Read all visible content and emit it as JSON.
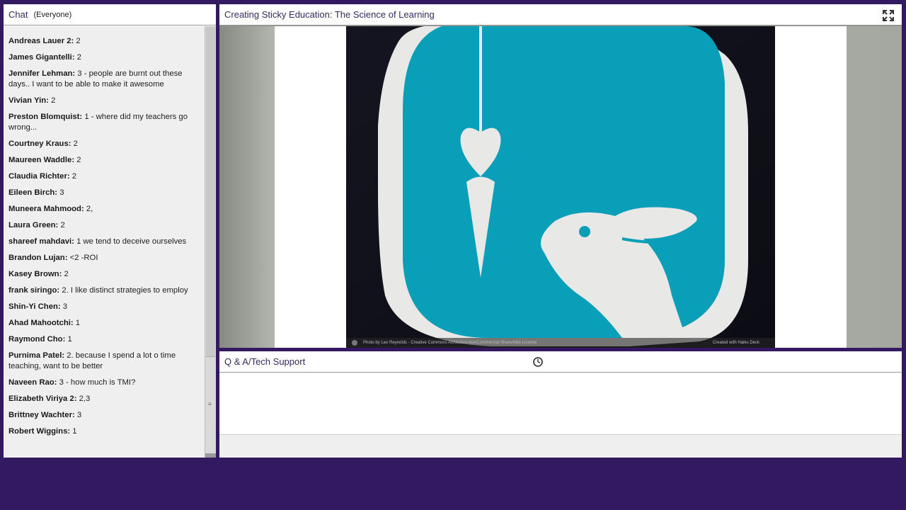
{
  "chat": {
    "title": "Chat",
    "audience": "(Everyone)",
    "messages": [
      {
        "name": "Andreas Lauer 2:",
        "text": " 2"
      },
      {
        "name": "James Gigantelli:",
        "text": " 2"
      },
      {
        "name": "Jennifer Lehman:",
        "text": " 3 - people are burnt out these days.. I want to be able to make it awesome"
      },
      {
        "name": "Vivian Yin:",
        "text": " 2"
      },
      {
        "name": "Preston Blomquist:",
        "text": " 1 - where did my teachers go wrong..."
      },
      {
        "name": "Courtney Kraus:",
        "text": " 2"
      },
      {
        "name": "Maureen Waddle:",
        "text": " 2"
      },
      {
        "name": "Claudia Richter:",
        "text": " 2"
      },
      {
        "name": "Eileen Birch:",
        "text": " 3"
      },
      {
        "name": "Muneera Mahmood:",
        "text": " 2,"
      },
      {
        "name": "Laura Green:",
        "text": " 2"
      },
      {
        "name": "shareef mahdavi:",
        "text": " 1 we tend to deceive ourselves"
      },
      {
        "name": "Brandon Lujan:",
        "text": " <2 -ROI"
      },
      {
        "name": "Kasey Brown:",
        "text": " 2"
      },
      {
        "name": "frank siringo:",
        "text": " 2. I like distinct strategies to employ"
      },
      {
        "name": "Shin-Yi Chen:",
        "text": " 3"
      },
      {
        "name": "Ahad Mahootchi:",
        "text": " 1"
      },
      {
        "name": "Raymond Cho:",
        "text": " 1"
      },
      {
        "name": "Purnima Patel:",
        "text": " 2. because I spend a lot o time teaching, want to be better"
      },
      {
        "name": "Naveen Rao:",
        "text": " 3 - how much is TMI?"
      },
      {
        "name": "Elizabeth Viriya 2:",
        "text": " 2,3"
      },
      {
        "name": "Brittney Wachter:",
        "text": " 3"
      },
      {
        "name": "Robert Wiggins:",
        "text": " 1"
      }
    ]
  },
  "share": {
    "title": "Creating Sticky Education: The Science of Learning",
    "credit": "Photo by Leo Reynolds - Creative Commons Attribution-NonCommercial-ShareAlike License",
    "deck": "Created with Haiku Deck"
  },
  "qa": {
    "title": "Q & A/Tech Support"
  },
  "icons": {
    "fullscreen": "fullscreen-icon",
    "cursor": "busy-cursor-icon"
  },
  "colors": {
    "background": "#33195f",
    "title_text": "#3a2a62",
    "slide_teal": "#0a9fb9"
  }
}
